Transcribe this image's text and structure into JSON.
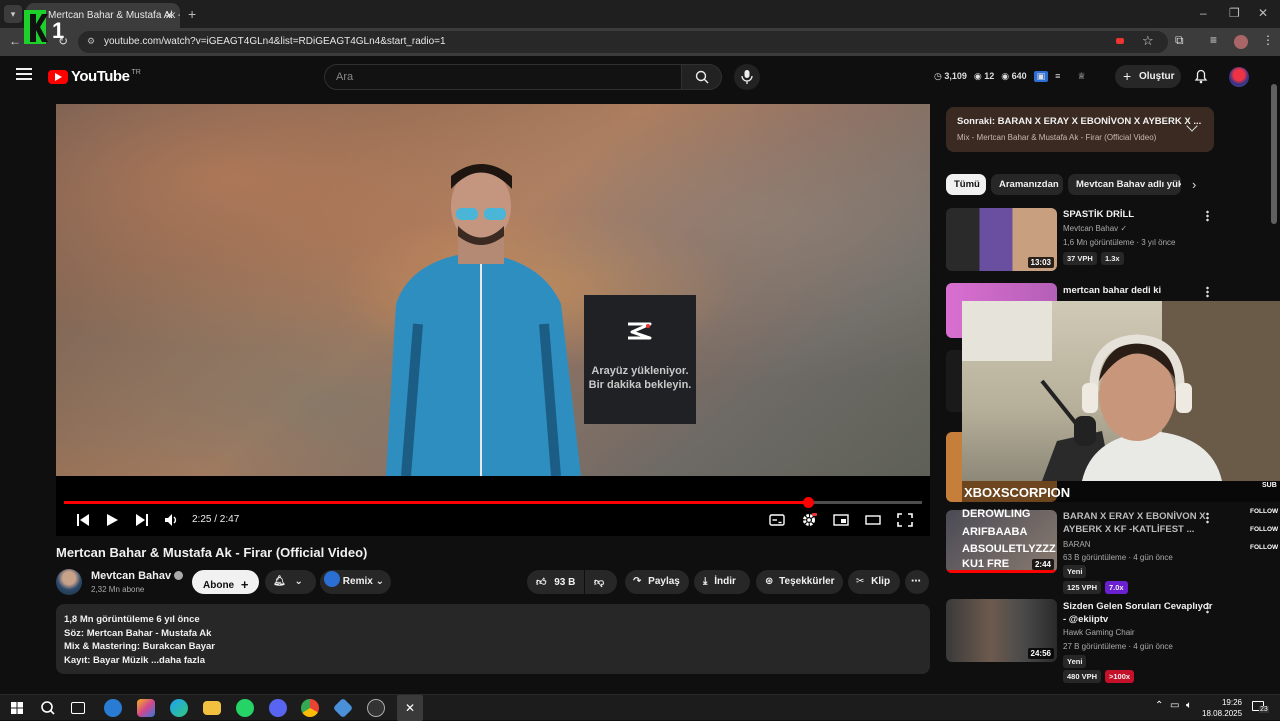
{
  "browser": {
    "tab_title": "Mertcan Bahar & Mustafa Ak - Firar (Official Video)",
    "tab_title_short": "Mertcan Bahar & Mustafa Ak -",
    "url": "youtube.com/watch?v=iGEAGT4GLn4&list=RDiGEAGT4GLn4&start_radio=1",
    "overlay_logo_text": "1"
  },
  "header": {
    "logo_text": "YouTube",
    "country_code": "TR",
    "search_placeholder": "Ara",
    "stats": {
      "a": "3,109",
      "b": "12",
      "c": "640"
    },
    "create_label": "Oluştur"
  },
  "player": {
    "loading_text": "Arayüz yükleniyor. Bir dakika bekleyin.",
    "time": "2:25 / 2:47",
    "progress": 0.867
  },
  "video": {
    "title": "Mertcan Bahar & Mustafa Ak - Firar (Official Video)",
    "channel": "Mevtcan Bahav",
    "subscribers": "2,32 Mn abone",
    "subscribe_label": "Abone",
    "remix_label": "Remix",
    "likes": "93 B",
    "share_label": "Paylaş",
    "download_label": "İndir",
    "thanks_label": "Teşekkürler",
    "clip_label": "Klip",
    "description": {
      "views_line": "1,8 Mn görüntüleme  6 yıl önce",
      "line2": "Söz: Mertcan Bahar - Mustafa Ak",
      "line3": "Mix & Mastering: Burakcan Bayar",
      "line4": "Kayıt: Bayar Müzik",
      "more": "...daha fazla"
    }
  },
  "sidebar": {
    "up_next_label": "Sonraki:",
    "up_next_title": "BARAN X ERAY X EBONİVON X AYBERK X ...",
    "up_next_sub": "Mix - Mertcan Bahar & Mustafa Ak - Firar (Official Video)",
    "chips": [
      "Tümü",
      "Aramanızdan",
      "Mevtcan Bahav adlı yük"
    ],
    "items": [
      {
        "title": "SPASTİK DRİLL",
        "channel": "Mevtcan Bahav",
        "meta": "1,6 Mn görüntüleme · 3 yıl önce",
        "duration": "13:03",
        "badge1": "37 VPH",
        "badge2": "1.3x"
      },
      {
        "title": "mertcan bahar dedi ki"
      },
      {
        "title": "BARAN X ERAY X EBONİVON X AYBERK X KF -KATLİFEST ...",
        "channel": "BARAN",
        "meta": "63 B görüntüleme · 4 gün önce",
        "tag": "Yeni",
        "duration": "2:44",
        "badge1": "125 VPH",
        "badge2": "7.0x"
      },
      {
        "title": "Sizden Gelen Soruları Cevaplıyor - @ekiiptv",
        "channel": "Hawk Gaming Chair",
        "meta": "27 B görüntüleme · 4 gün önce",
        "tag": "Yeni",
        "duration": "24:56",
        "badge1": "480 VPH",
        "badge2": ">100x"
      }
    ]
  },
  "stream_overlay": {
    "cam_name": "XBOXSCORPION",
    "sub_label": "SUB",
    "follow_label": "FOLLOW",
    "alerts": [
      "DEROWLING",
      "ARIFBAABA",
      "ABSOULETLYZZZ",
      "KU1 FRE"
    ]
  },
  "taskbar": {
    "time": "19:26",
    "date": "18.08.2025",
    "notif": "23"
  },
  "colors": {
    "accent": "#ff0000",
    "background": "#0f0f0f",
    "up_next_bg": "#3a2a22",
    "badge_green": "#3e3e3e",
    "badge_purple": "#6a1fd0",
    "badge_red": "#c5102a"
  }
}
